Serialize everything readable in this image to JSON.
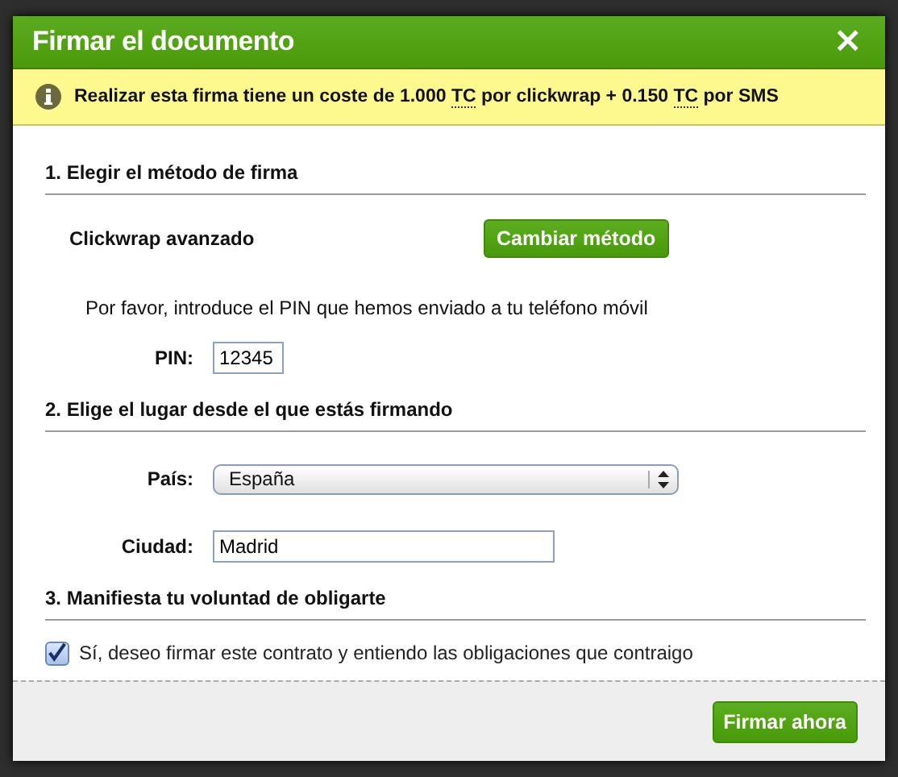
{
  "dialog": {
    "title": "Firmar el documento",
    "close": "×"
  },
  "notice": {
    "segments": [
      {
        "text": "Realizar esta firma tiene un coste de 1.000 ",
        "abbr": false
      },
      {
        "text": "TC",
        "abbr": true
      },
      {
        "text": " por clickwrap + 0.150 ",
        "abbr": false
      },
      {
        "text": "TC",
        "abbr": true
      },
      {
        "text": " por SMS",
        "abbr": false
      }
    ]
  },
  "sections": [
    {
      "heading": "1. Elegir el método de firma",
      "rows": [
        {
          "kind": "method",
          "label": "Clickwrap avanzado",
          "button": "Cambiar método"
        },
        {
          "kind": "text",
          "text": "Por favor, introduce el PIN que hemos enviado a tu teléfono móvil"
        },
        {
          "kind": "short-input",
          "label": "PIN:",
          "value": "12345"
        }
      ]
    },
    {
      "heading": "2. Elige el lugar desde el que estás firmando",
      "rows": [
        {
          "kind": "select",
          "label": "País:",
          "value": "España"
        },
        {
          "kind": "input",
          "label": "Ciudad:",
          "value": "Madrid"
        }
      ]
    },
    {
      "heading": "3. Manifiesta tu voluntad de obligarte",
      "rows": [
        {
          "kind": "checkbox",
          "label": "Sí, deseo firmar este contrato y entiendo las obligaciones que contraigo",
          "checked": true
        }
      ]
    }
  ],
  "footer": {
    "button": "Firmar ahora"
  }
}
